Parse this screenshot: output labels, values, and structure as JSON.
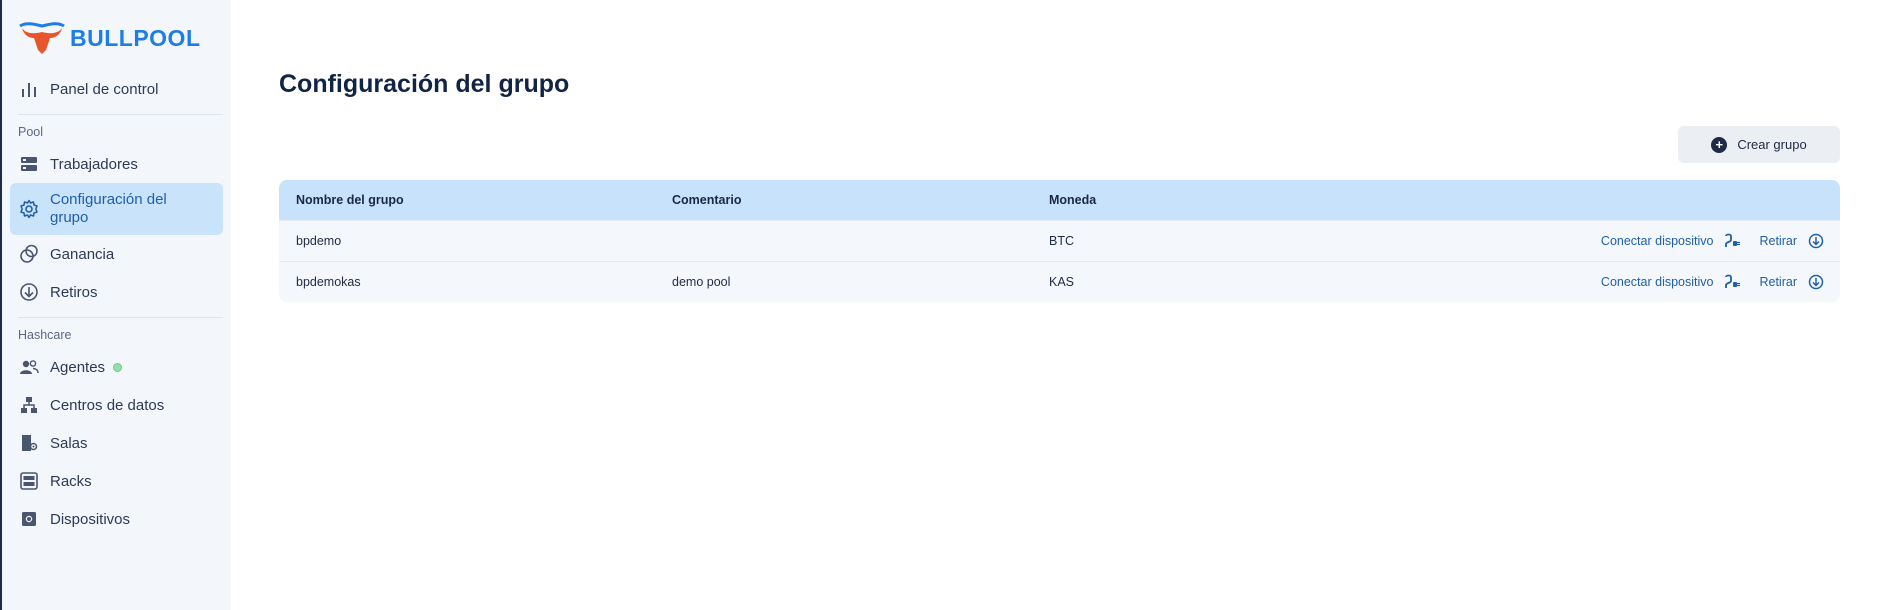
{
  "brand": {
    "name": "BULLPOOL"
  },
  "sidebar": {
    "top": [
      {
        "label": "Panel de control",
        "icon": "bar-chart-icon"
      }
    ],
    "sections": [
      {
        "title": "Pool",
        "items": [
          {
            "label": "Trabajadores",
            "icon": "server-icon"
          },
          {
            "label": "Configuración del grupo",
            "icon": "gear-icon",
            "active": true
          },
          {
            "label": "Ganancia",
            "icon": "coins-icon"
          },
          {
            "label": "Retiros",
            "icon": "download-circle-icon"
          }
        ]
      },
      {
        "title": "Hashcare",
        "items": [
          {
            "label": "Agentes",
            "icon": "users-icon",
            "status": "online"
          },
          {
            "label": "Centros de datos",
            "icon": "hierarchy-icon"
          },
          {
            "label": "Salas",
            "icon": "room-icon"
          },
          {
            "label": "Racks",
            "icon": "rack-icon"
          },
          {
            "label": "Dispositivos",
            "icon": "chip-icon"
          }
        ]
      }
    ]
  },
  "main": {
    "title": "Configuración del grupo",
    "create_button": "Crear grupo",
    "table": {
      "headers": [
        "Nombre del grupo",
        "Comentario",
        "Moneda",
        ""
      ],
      "rows": [
        {
          "name": "bpdemo",
          "comment": "",
          "currency": "BTC"
        },
        {
          "name": "bpdemokas",
          "comment": "demo pool",
          "currency": "KAS"
        }
      ],
      "actions": {
        "connect": "Conectar dispositivo",
        "withdraw": "Retirar"
      }
    }
  },
  "colors": {
    "accent": "#1e7ee6",
    "active_bg": "#c9e3fb",
    "header_bg": "#c8e2fb",
    "link": "#1f5fa8"
  }
}
